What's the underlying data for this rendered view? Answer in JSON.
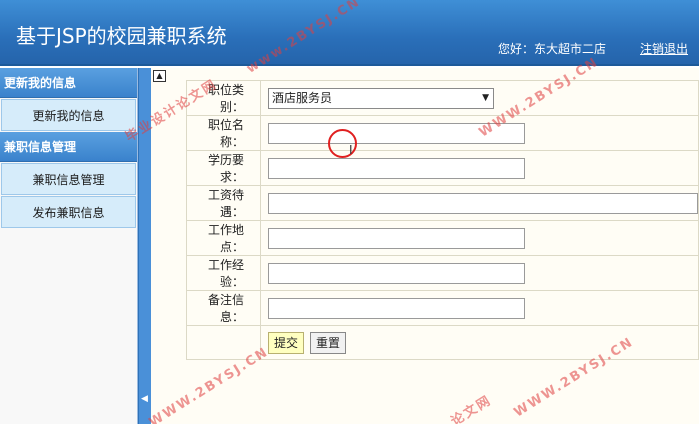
{
  "header": {
    "title": "基于JSP的校园兼职系统",
    "greeting_label": "您好：",
    "user_name": "东大超市二店",
    "logout": "注销退出"
  },
  "sidebar": {
    "groups": [
      {
        "title": "更新我的信息",
        "items": [
          {
            "label": "更新我的信息"
          }
        ]
      },
      {
        "title": "兼职信息管理",
        "items": [
          {
            "label": "兼职信息管理"
          },
          {
            "label": "发布兼职信息"
          }
        ]
      }
    ],
    "collapse_arrow": "◀"
  },
  "form": {
    "category_label": "职位类别：",
    "category_value": "酒店服务员",
    "name_label": "职位名称：",
    "name_value": "",
    "education_label": "学历要求：",
    "education_value": "",
    "salary_label": "工资待遇：",
    "salary_value": "",
    "location_label": "工作地点：",
    "location_value": "",
    "experience_label": "工作经验：",
    "experience_value": "",
    "remark_label": "备注信息：",
    "remark_value": "",
    "submit_label": "提交",
    "reset_label": "重置"
  },
  "watermarks": {
    "site": "www.2BYSJ.CN",
    "site_upper": "WWW.2BYSJ.CN",
    "name_full": "毕业设计论文网",
    "name_part": "论文网"
  },
  "colors": {
    "header_bg": "#2a6fb9",
    "sidebar_item_bg": "#d6ecfa",
    "content_bg": "#fffdf5",
    "submit_bg": "#ffffc0",
    "watermark": "#e04040"
  }
}
